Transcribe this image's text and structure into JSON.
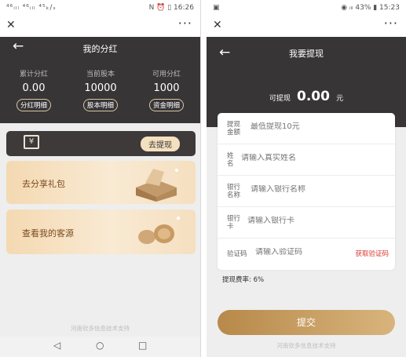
{
  "left": {
    "status_left": "⁴⁶ᵢₗₗ ⁴⁶ᵢₗₗ ⁴⁵ₖ/ₛ",
    "status_right": "N ⏰ ▯ 16:26",
    "close_icon": "✕",
    "more_icon": "···",
    "back_icon": "←",
    "title": "我的分红",
    "stats": [
      {
        "label": "累计分红",
        "value": "0.00",
        "button": "分红明细"
      },
      {
        "label": "当前股本",
        "value": "10000",
        "button": "股本明细"
      },
      {
        "label": "可用分红",
        "value": "1000",
        "button": "资金明细"
      }
    ],
    "withdraw_icon": "¥",
    "withdraw_button": "去提现",
    "card1": "去分享礼包",
    "card2": "查看我的客源",
    "footer": "河南钦多信息技术支持",
    "nav_back": "◁",
    "nav_home": "○",
    "nav_recent": "□"
  },
  "right": {
    "status_right": "◉ ᵢₗₗ 43% ▮ 15:23",
    "close_icon": "✕",
    "more_icon": "···",
    "back_icon": "←",
    "title": "我要提现",
    "available_label": "可提现",
    "available_value": "0.00",
    "available_unit": "元",
    "fields": [
      {
        "label": "提现金额",
        "placeholder": "最低提现10元"
      },
      {
        "label": "姓名",
        "placeholder": "请输入真实姓名"
      },
      {
        "label": "银行名称",
        "placeholder": "请输入银行名称"
      },
      {
        "label": "银行卡",
        "placeholder": "请输入银行卡"
      },
      {
        "label": "验证码",
        "placeholder": "请输入验证码"
      }
    ],
    "get_code": "获取验证码",
    "fee": "提现费率: 6%",
    "submit": "提交",
    "footer": "河南钦多信息技术支持"
  },
  "colors": {
    "dark": "#383536",
    "gold": "#c49a5c",
    "accent_red": "#d9352f"
  }
}
